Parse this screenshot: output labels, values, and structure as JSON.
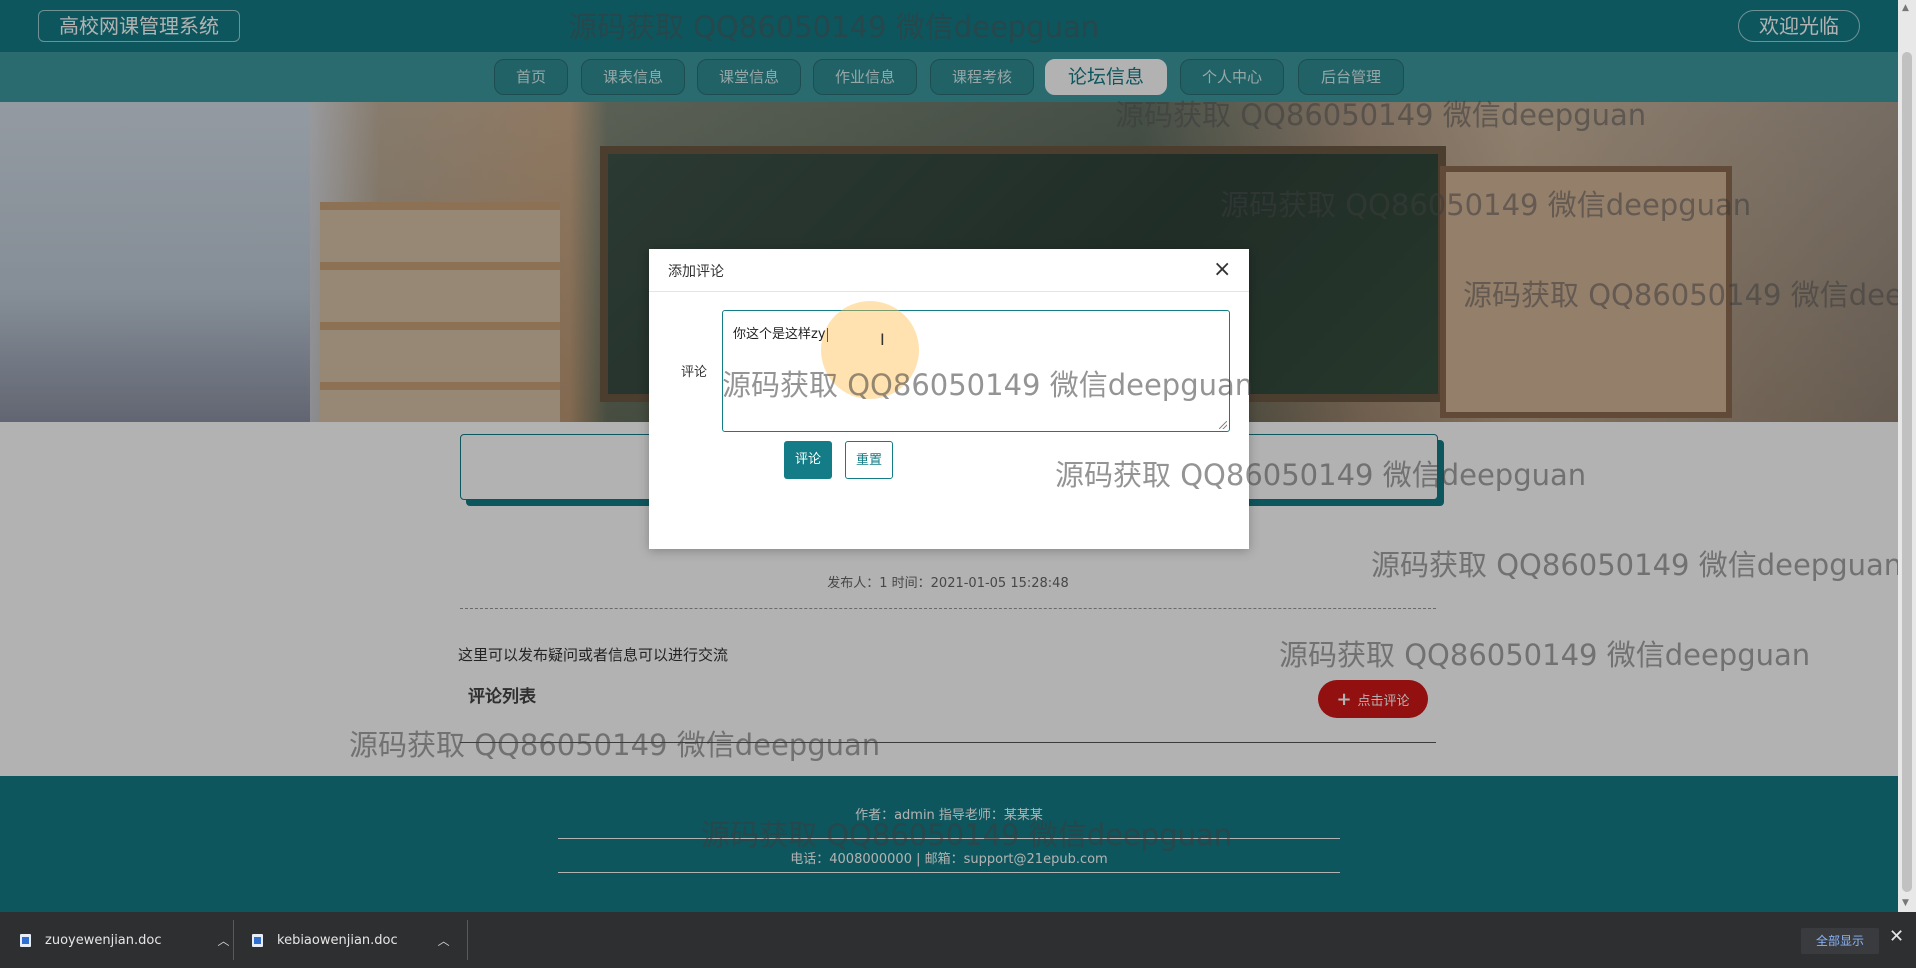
{
  "header": {
    "site_title": "高校网课管理系统",
    "welcome": "欢迎光临"
  },
  "nav": {
    "items": [
      "首页",
      "课表信息",
      "课堂信息",
      "作业信息",
      "课程考核",
      "论坛信息",
      "个人中心",
      "后台管理"
    ],
    "active": "论坛信息"
  },
  "post": {
    "meta": "发布人：1 时间：2021-01-05 15:28:48",
    "content": "这里可以发布疑问或者信息可以进行交流",
    "comment_list_title": "评论列表",
    "comment_button_label": "点击评论"
  },
  "footer": {
    "line1": "作者：admin 指导老师：某某某",
    "line2": "电话：4008000000 | 邮箱：support@21epub.com"
  },
  "modal": {
    "title": "添加评论",
    "field_label": "评论",
    "textarea_value": "你这个是这样zy",
    "submit_label": "评论",
    "reset_label": "重置"
  },
  "watermark_text": "源码获取 QQ86050149 微信deepguan",
  "downloads": {
    "items": [
      "zuoyewenjian.doc",
      "kebiaowenjian.doc"
    ],
    "show_all": "全部显示"
  },
  "colors": {
    "primary": "#137c86",
    "nav_bg": "#3d9a9f",
    "danger": "#d11717"
  }
}
